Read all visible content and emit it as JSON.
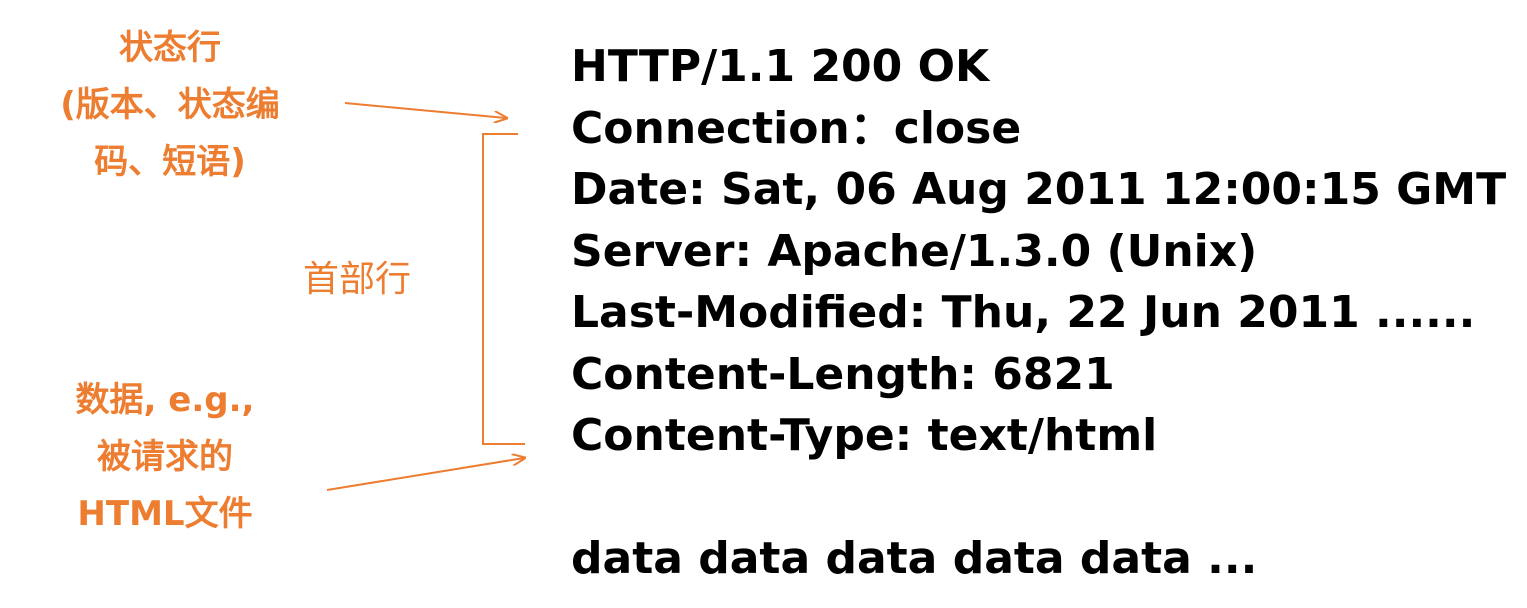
{
  "annotations": {
    "status_line": [
      "状态行",
      "(版本、状态编",
      "码、短语)"
    ],
    "header_lines": "首部行",
    "data": [
      "数据, e.g.,",
      "被请求的",
      "HTML文件"
    ]
  },
  "message": {
    "status_line": "HTTP/1.1 200 OK",
    "headers": [
      "Connection：close",
      "Date: Sat, 06 Aug 2011 12:00:15 GMT",
      "Server: Apache/1.3.0 (Unix)",
      "Last-Modified: Thu, 22 Jun 2011 ......",
      "Content-Length: 6821",
      "Content-Type: text/html"
    ],
    "body": "data data data data data ..."
  },
  "colors": {
    "annotation": "#ED7D31",
    "message_text": "#000000"
  }
}
